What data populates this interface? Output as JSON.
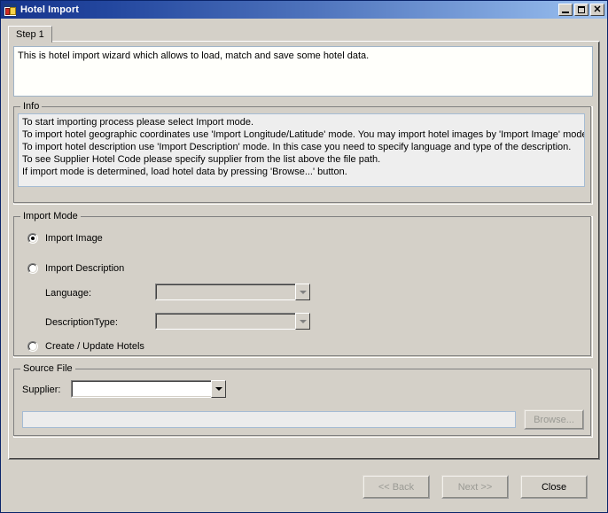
{
  "window": {
    "title": "Hotel Import",
    "icon": "form-window-icon",
    "controls": {
      "minimize": "minimize-button",
      "maximize": "maximize-button",
      "close": "close-button",
      "close_glyph": "✕"
    }
  },
  "tabs": [
    {
      "label": "Step 1",
      "selected": true
    }
  ],
  "description": {
    "text": "This is hotel import wizard which allows to load, match and save some hotel data."
  },
  "info_group": {
    "title": "Info",
    "lines": [
      "To start importing process please select Import mode.",
      "To import hotel geographic coordinates use 'Import Longitude/Latitude' mode. You may import hotel images by 'Import Image' mode.",
      "To import hotel description use 'Import Description' mode. In this case you need to specify language and type of the description.",
      "To see Supplier Hotel Code please specify supplier from the list above the file path.",
      "If import mode is determined, load hotel data by pressing 'Browse...' button."
    ]
  },
  "import_mode_group": {
    "title": "Import Mode",
    "options": [
      {
        "label": "Import Image",
        "checked": true
      },
      {
        "label": "Import Description",
        "checked": false
      },
      {
        "label": "Create / Update Hotels",
        "checked": false
      }
    ],
    "fields": [
      {
        "label": "Language:",
        "value": "",
        "placeholder": "",
        "enabled": false
      },
      {
        "label": "DescriptionType:",
        "value": "",
        "placeholder": "",
        "enabled": false
      }
    ]
  },
  "source_file_group": {
    "title": "Source File",
    "supplier_label": "Supplier:",
    "supplier_value": "",
    "supplier_enabled": true,
    "path_value": "",
    "path_enabled": false,
    "browse_label": "Browse...",
    "browse_enabled": false
  },
  "footer": {
    "buttons": [
      {
        "label": "<< Back",
        "enabled": false
      },
      {
        "label": "Next >>",
        "enabled": false
      },
      {
        "label": "Close",
        "enabled": true
      }
    ]
  },
  "colors": {
    "window_face": "#d4d0c8",
    "title_left": "#16348c",
    "title_right": "#9fc0ec",
    "field_white": "#ffffff",
    "info_bg": "#eeeeee",
    "disabled_text": "#9a9a94"
  }
}
